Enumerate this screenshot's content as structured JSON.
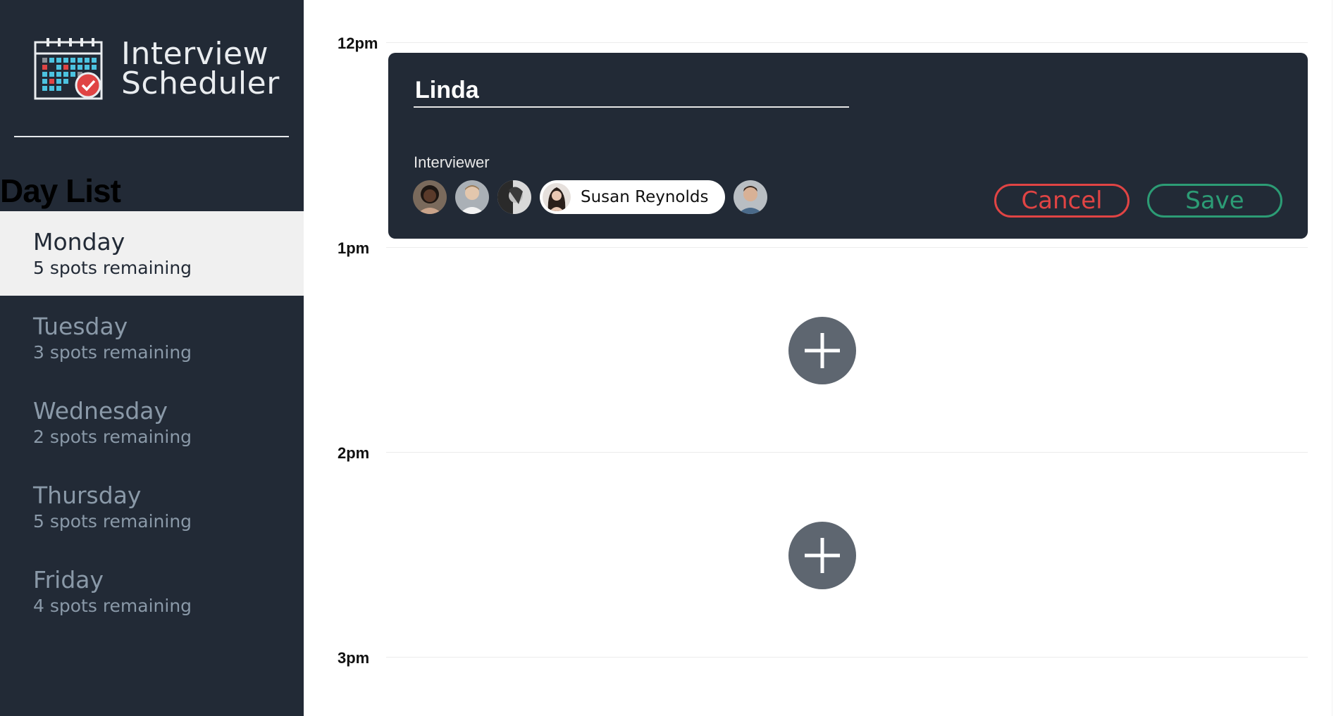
{
  "app": {
    "title_line1": "Interview",
    "title_line2": "Scheduler",
    "logo_icon": "calendar-check-icon"
  },
  "sidebar": {
    "heading": "Day List",
    "days": [
      {
        "name": "Monday",
        "spots": "5 spots remaining",
        "selected": true
      },
      {
        "name": "Tuesday",
        "spots": "3 spots remaining",
        "selected": false
      },
      {
        "name": "Wednesday",
        "spots": "2 spots remaining",
        "selected": false
      },
      {
        "name": "Thursday",
        "spots": "5 spots remaining",
        "selected": false
      },
      {
        "name": "Friday",
        "spots": "4 spots remaining",
        "selected": false
      }
    ]
  },
  "schedule": {
    "times": [
      "12pm",
      "1pm",
      "2pm",
      "3pm"
    ],
    "add_icon": "plus-icon"
  },
  "form": {
    "student_name": "Linda",
    "interviewer_label": "Interviewer",
    "selected_interviewer": "Susan Reynolds",
    "cancel_label": "Cancel",
    "save_label": "Save"
  },
  "colors": {
    "sidebar_bg": "#222a36",
    "selected_day_bg": "#f0f0f0",
    "cancel": "#e04444",
    "save": "#2c9c75",
    "add_button": "#5e6670"
  }
}
